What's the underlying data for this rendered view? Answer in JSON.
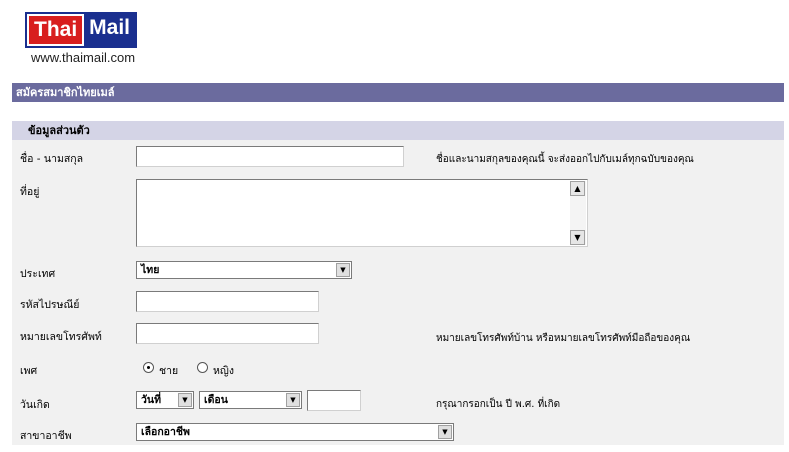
{
  "logo": {
    "part1": "Thai",
    "part2": "Mail"
  },
  "site_url": "www.thaimail.com",
  "page_title": "สมัครสมาชิกไทยเมล์",
  "section_title": "ข้อมูลส่วนตัว",
  "fields": {
    "name": {
      "label": "ชื่อ - นามสกุล",
      "value": "",
      "hint": "ชื่อและนามสกุลของคุณนี้ จะส่งออกไปกับเมล์ทุกฉบับของคุณ"
    },
    "address": {
      "label": "ที่อยู่",
      "value": ""
    },
    "country": {
      "label": "ประเทศ",
      "selected": "ไทย"
    },
    "postcode": {
      "label": "รหัสไปรษณีย์",
      "value": ""
    },
    "phone": {
      "label": "หมายเลขโทรศัพท์",
      "value": "",
      "hint": "หมายเลขโทรศัพท์บ้าน หรือหมายเลขโทรศัพท์มือถือของคุณ"
    },
    "gender": {
      "label": "เพศ",
      "options": [
        "ชาย",
        "หญิง"
      ],
      "selected": "ชาย"
    },
    "birthdate": {
      "label": "วันเกิด",
      "day": "วันที่",
      "month": "เดือน",
      "year": "",
      "hint": "กรุณากรอกเป็น ปี พ.ศ. ที่เกิด"
    },
    "occupation": {
      "label": "สาขาอาชีพ",
      "selected": "เลือกอาชีพ"
    }
  },
  "icons": {
    "scroll_up": "▲",
    "scroll_down": "▼",
    "dropdown": "▼"
  },
  "colors": {
    "title_bar": "#6b6b9e",
    "section_bar": "#d4d4e6",
    "form_bg": "#f1f1f1",
    "logo_red": "#d81e1e",
    "logo_blue": "#1a2f8f"
  }
}
